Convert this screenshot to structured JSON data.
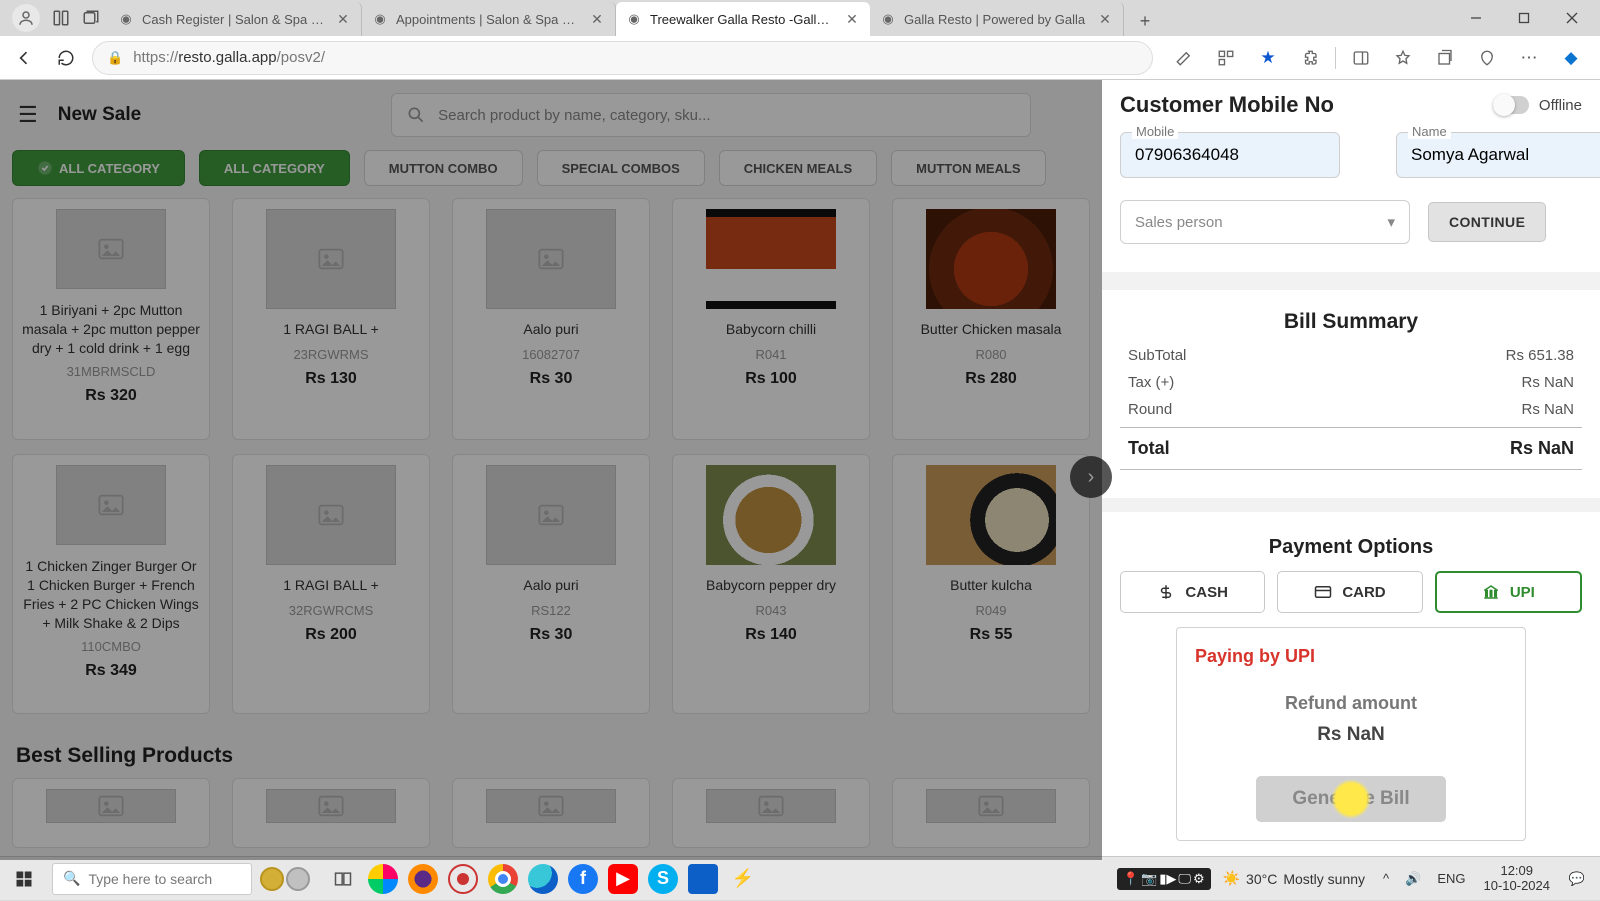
{
  "browser": {
    "tabs": [
      {
        "title": "Cash Register | Salon & Spa Mana"
      },
      {
        "title": "Appointments | Salon & Spa Man"
      },
      {
        "title": "Treewalker Galla Resto -Galla App",
        "active": true
      },
      {
        "title": "Galla Resto | Powered by Galla"
      }
    ],
    "url_scheme": "https://",
    "url_host": "resto.galla.app",
    "url_path": "/posv2/"
  },
  "header": {
    "page_title": "New Sale",
    "search_placeholder": "Search product by name, category, sku..."
  },
  "chips": {
    "all1": "ALL CATEGORY",
    "all2": "ALL CATEGORY",
    "c1": "MUTTON COMBO",
    "c2": "SPECIAL COMBOS",
    "c3": "CHICKEN MEALS",
    "c4": "MUTTON MEALS"
  },
  "grid": {
    "row1": [
      {
        "title": "1 Biriyani + 2pc Mutton masala + 2pc mutton pepper dry + 1 cold drink + 1 egg",
        "sku": "31MBRMSCLD",
        "price": "Rs 320"
      },
      {
        "title": "1 RAGI BALL +",
        "sku": "23RGWRMS",
        "price": "Rs 130"
      },
      {
        "title": "Aalo puri",
        "sku": "16082707",
        "price": "Rs 30"
      },
      {
        "title": "Babycorn chilli",
        "sku": "R041",
        "price": "Rs 100"
      },
      {
        "title": "Butter Chicken masala",
        "sku": "R080",
        "price": "Rs 280"
      }
    ],
    "row2": [
      {
        "title": "1 Chicken Zinger Burger Or 1 Chicken Burger + French Fries + 2 PC Chicken Wings + Milk Shake & 2 Dips",
        "sku": "110CMBO",
        "price": "Rs 349"
      },
      {
        "title": "1 RAGI BALL +",
        "sku": "32RGWRCMS",
        "price": "Rs 200"
      },
      {
        "title": "Aalo puri",
        "sku": "RS122",
        "price": "Rs 30"
      },
      {
        "title": "Babycorn pepper dry",
        "sku": "R043",
        "price": "Rs 140"
      },
      {
        "title": "Butter kulcha",
        "sku": "R049",
        "price": "Rs 55"
      }
    ],
    "best_selling_title": "Best Selling Products"
  },
  "panel": {
    "customer_title": "Customer Mobile No",
    "offline": "Offline",
    "mobile_label": "Mobile",
    "mobile_value": "07906364048",
    "name_label": "Name",
    "name_value": "Somya Agarwal",
    "salesperson_placeholder": "Sales person",
    "continue_label": "CONTINUE",
    "bill_title": "Bill Summary",
    "subtotal_label": "SubTotal",
    "subtotal_value": "Rs 651.38",
    "tax_label": "Tax (+)",
    "tax_value": "Rs NaN",
    "round_label": "Round",
    "round_value": "Rs NaN",
    "total_label": "Total",
    "total_value": "Rs NaN",
    "pay_title": "Payment Options",
    "pay_cash": "CASH",
    "pay_card": "CARD",
    "pay_upi": "UPI",
    "paying_by": "Paying by UPI",
    "refund_label": "Refund amount",
    "refund_value": "Rs NaN",
    "generate_bill": "Generate Bill"
  },
  "taskbar": {
    "search_placeholder": "Type here to search",
    "temp": "30°C",
    "weather": "Mostly sunny",
    "lang": "ENG",
    "time": "12:09",
    "date": "10-10-2024"
  }
}
